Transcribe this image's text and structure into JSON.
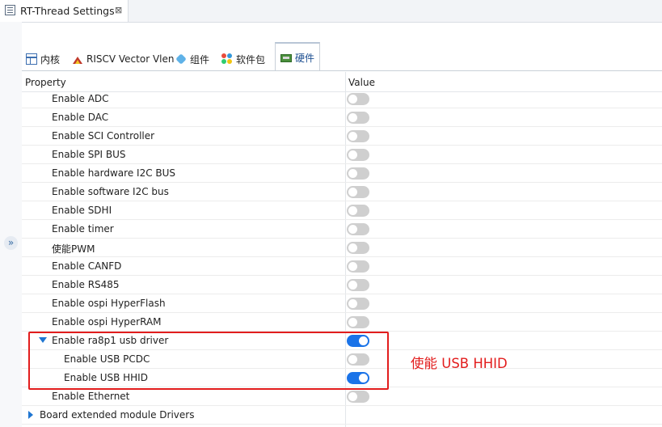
{
  "editor": {
    "title": "RT-Thread Settings",
    "close_glyph": "⊠"
  },
  "sidebar": {
    "expand_glyph": "»"
  },
  "tabs": [
    {
      "label": "内核",
      "icon": "table-icon",
      "active": false
    },
    {
      "label": "RISCV Vector Vlen",
      "icon": "riscv-logo-icon",
      "active": false
    },
    {
      "label": "组件",
      "icon": "cube-icon",
      "active": false
    },
    {
      "label": "软件包",
      "icon": "package-icon",
      "active": false
    },
    {
      "label": "硬件",
      "icon": "board-icon",
      "active": true
    }
  ],
  "grid": {
    "header_property": "Property",
    "header_value": "Value",
    "rows": [
      {
        "label": "Enable ADC",
        "enabled": false
      },
      {
        "label": "Enable DAC",
        "enabled": false
      },
      {
        "label": "Enable SCI Controller",
        "enabled": false
      },
      {
        "label": "Enable SPI BUS",
        "enabled": false
      },
      {
        "label": "Enable hardware I2C BUS",
        "enabled": false
      },
      {
        "label": "Enable software I2C bus",
        "enabled": false
      },
      {
        "label": "Enable SDHI",
        "enabled": false
      },
      {
        "label": "Enable timer",
        "enabled": false
      },
      {
        "label": "使能PWM",
        "enabled": false
      },
      {
        "label": "Enable CANFD",
        "enabled": false
      },
      {
        "label": "Enable RS485",
        "enabled": false
      },
      {
        "label": "Enable ospi HyperFlash",
        "enabled": false
      },
      {
        "label": "Enable ospi HyperRAM",
        "enabled": false
      },
      {
        "label": "Enable ra8p1 usb driver",
        "enabled": true,
        "expander": "open"
      },
      {
        "label": "Enable USB PCDC",
        "enabled": false
      },
      {
        "label": "Enable USB HHID",
        "enabled": true
      },
      {
        "label": "Enable Ethernet",
        "enabled": false
      },
      {
        "label": "Board extended module Drivers",
        "expander": "closed"
      }
    ]
  },
  "annotation": {
    "text": "使能 USB HHID",
    "color": "#e21d1d"
  },
  "colors": {
    "toggle_on": "#1a73e8",
    "toggle_off": "#cfcfcf",
    "expander": "#1f76d2"
  }
}
